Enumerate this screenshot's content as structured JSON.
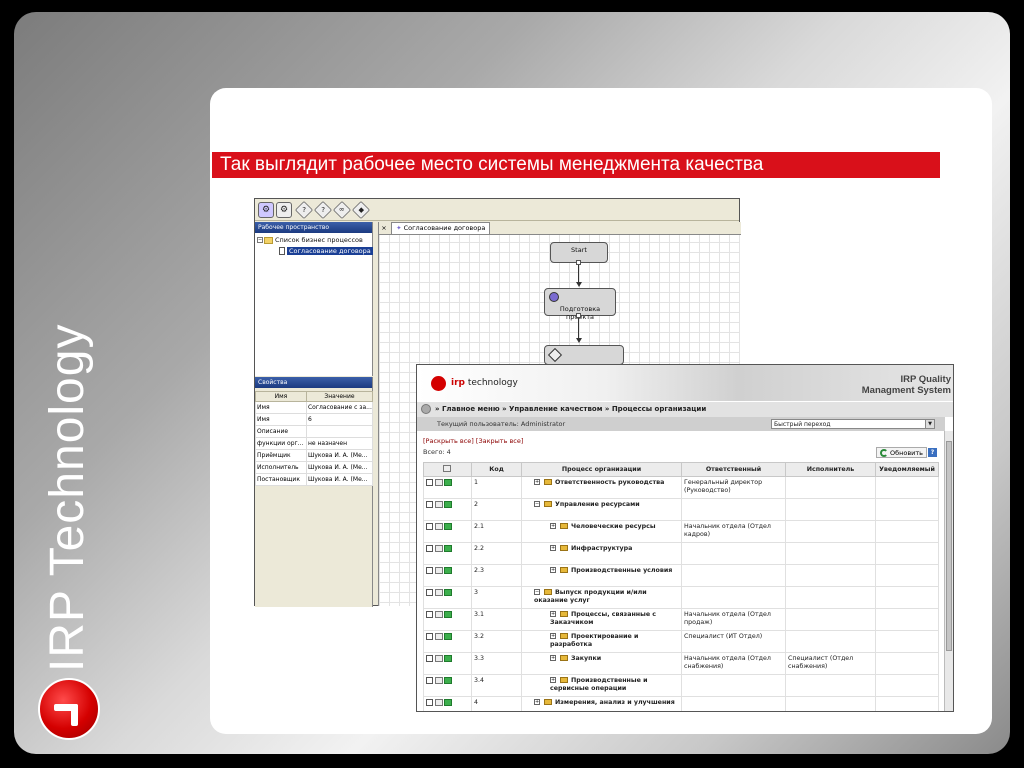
{
  "slide": {
    "brand_vertical": "IRP Technology",
    "title": "Так выглядит рабочее место системы менеджмента качества"
  },
  "workflow_editor": {
    "toolbar_icons": [
      "settings-icon",
      "gear-icon",
      "help-icon",
      "help-icon",
      "gateway-icon",
      "decision-icon"
    ],
    "workspace_panel": {
      "header": "Рабочее пространство",
      "tree": [
        {
          "label": "Список бизнес процессов",
          "type": "folder"
        },
        {
          "label": "Согласование договора",
          "type": "document",
          "selected": true
        }
      ]
    },
    "properties_panel": {
      "header": "Свойства",
      "columns": [
        "Имя",
        "Значение"
      ],
      "rows": [
        [
          "Имя",
          "Согласование с за..."
        ],
        [
          "Имя",
          "6"
        ],
        [
          "Описание",
          ""
        ],
        [
          "функции орг...",
          "не назначен"
        ],
        [
          "Приёмщик",
          "Шукова И. А. (Ме..."
        ],
        [
          "Исполнитель",
          "Шукова И. А. (Ме..."
        ],
        [
          "Постановщик",
          "Шукова И. А. (Ме..."
        ]
      ]
    },
    "diagram": {
      "tab_label": "Согласование договора",
      "nodes": {
        "start": "Start",
        "task": "Подготовка проекта"
      }
    }
  },
  "qms": {
    "logo_text_prefix": "irp",
    "logo_text_suffix": " technology",
    "product_line1": "IRP Quality",
    "product_line2": "Managment System",
    "breadcrumb": "» Главное меню » Управление качеством » Процессы организации",
    "current_user": "Текущий пользователь: Administrator",
    "quick_nav": "Быстрый переход",
    "expand_all": "[Раскрыть все]",
    "collapse_all": "[Закрыть все]",
    "total": "Всего: 4",
    "refresh": "Обновить",
    "help": "?",
    "columns": [
      "Код",
      "Процесс организации",
      "Ответственный",
      "Исполнитель",
      "Уведомляемый"
    ],
    "rows": [
      {
        "code": "1",
        "name": "Ответственность руководства",
        "level": 0,
        "expanded": false,
        "responsible": "Генеральный директор (Руководство)",
        "executor": "",
        "notified": ""
      },
      {
        "code": "2",
        "name": "Управление ресурсами",
        "level": 0,
        "expanded": true,
        "responsible": "",
        "executor": "",
        "notified": ""
      },
      {
        "code": "2.1",
        "name": "Человеческие ресурсы",
        "level": 1,
        "expanded": false,
        "responsible": "Начальник отдела (Отдел кадров)",
        "executor": "",
        "notified": ""
      },
      {
        "code": "2.2",
        "name": "Инфраструктура",
        "level": 1,
        "expanded": false,
        "responsible": "",
        "executor": "",
        "notified": ""
      },
      {
        "code": "2.3",
        "name": "Производственные условия",
        "level": 1,
        "expanded": false,
        "responsible": "",
        "executor": "",
        "notified": ""
      },
      {
        "code": "3",
        "name": "Выпуск продукции и/или оказание услуг",
        "level": 0,
        "expanded": true,
        "responsible": "",
        "executor": "",
        "notified": ""
      },
      {
        "code": "3.1",
        "name": "Процессы, связанные с Заказчиком",
        "level": 1,
        "expanded": false,
        "responsible": "Начальник отдела (Отдел продаж)",
        "executor": "",
        "notified": ""
      },
      {
        "code": "3.2",
        "name": "Проектирование и разработка",
        "level": 1,
        "expanded": false,
        "responsible": "Специалист (ИТ Отдел)",
        "executor": "",
        "notified": ""
      },
      {
        "code": "3.3",
        "name": "Закупки",
        "level": 1,
        "expanded": false,
        "responsible": "Начальник отдела (Отдел снабжения)",
        "executor": "Специалист (Отдел снабжения)",
        "notified": ""
      },
      {
        "code": "3.4",
        "name": "Производственные и сервисные операции",
        "level": 1,
        "expanded": false,
        "responsible": "",
        "executor": "",
        "notified": ""
      },
      {
        "code": "4",
        "name": "Измерения, анализ и улучшения",
        "level": 0,
        "expanded": false,
        "responsible": "",
        "executor": "",
        "notified": ""
      }
    ]
  }
}
